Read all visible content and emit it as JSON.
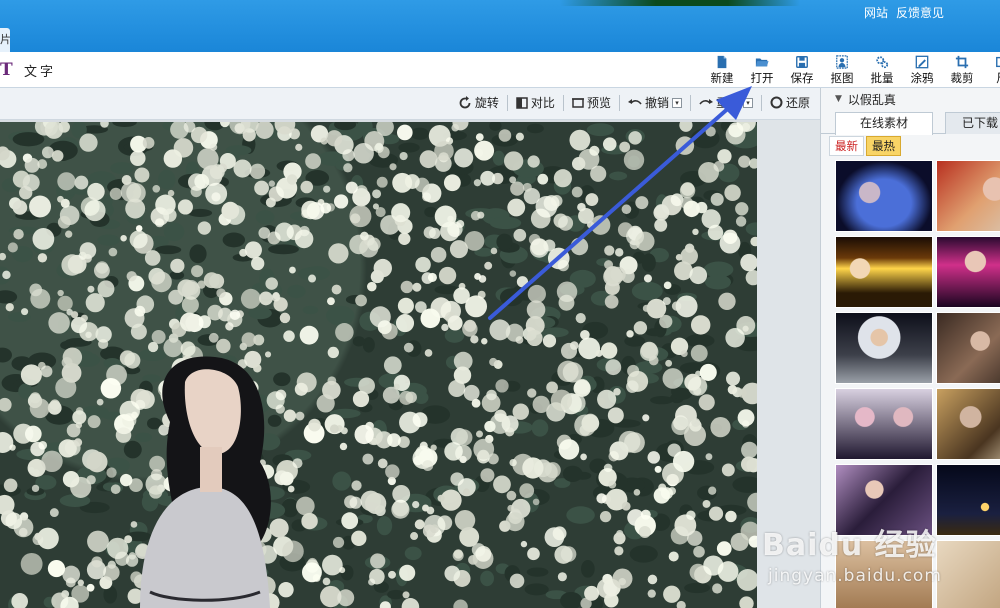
{
  "titlebar": {
    "links": [
      "网站",
      "反馈意见"
    ],
    "tab_stub": "片"
  },
  "toolbar": {
    "text_tool_label": "文字",
    "tools": [
      {
        "label": "新建",
        "icon": "new-file-icon"
      },
      {
        "label": "打开",
        "icon": "folder-open-icon"
      },
      {
        "label": "保存",
        "icon": "save-icon"
      },
      {
        "label": "抠图",
        "icon": "cutout-icon"
      },
      {
        "label": "批量",
        "icon": "batch-gear-icon"
      },
      {
        "label": "涂鸦",
        "icon": "doodle-icon"
      },
      {
        "label": "裁剪",
        "icon": "crop-icon"
      },
      {
        "label": "尺",
        "icon": "resize-icon"
      }
    ]
  },
  "subbar": {
    "rotate": "旋转",
    "compare": "对比",
    "preview": "预览",
    "undo": "撤销",
    "redo": "重做",
    "restore": "还原"
  },
  "panel": {
    "section_title": "以假乱真",
    "tabs": [
      "在线素材",
      "已下载"
    ],
    "subtabs": [
      "最新",
      "最热"
    ],
    "active_subtab": "最热"
  },
  "watermark": {
    "main": "Baidu 经验",
    "sub": "jingyan.baidu.com"
  },
  "colors": {
    "titlebar": "#1a86d8",
    "arrow": "#3a5bd9",
    "hot_tab": "#f8d466"
  }
}
